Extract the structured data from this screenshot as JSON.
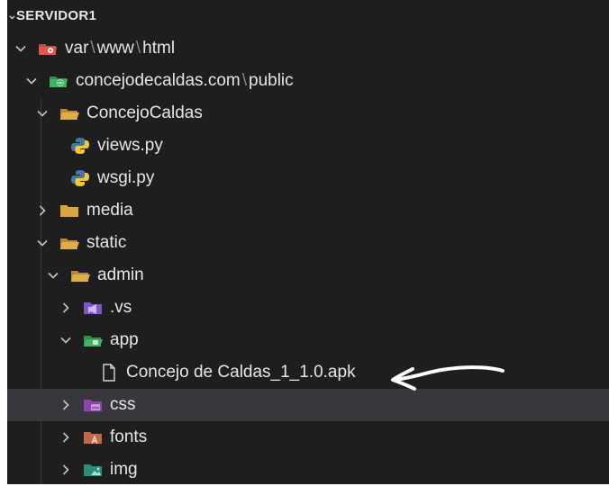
{
  "section": {
    "title": "SERVIDOR1"
  },
  "tree": {
    "root": {
      "part1": "var",
      "part2": "www",
      "part3": "html",
      "separator": "\\"
    },
    "site": {
      "part1": "concejodecaldas.com",
      "part2": "public",
      "separator": "\\"
    },
    "concejo_folder": "ConcejoCaldas",
    "views_file": "views.py",
    "wsgi_file": "wsgi.py",
    "media_folder": "media",
    "static_folder": "static",
    "admin_folder": "admin",
    "vs_folder": ".vs",
    "app_folder": "app",
    "apk_file": "Concejo de Caldas_1_1.0.apk",
    "css_folder": "css",
    "fonts_folder": "fonts",
    "img_folder": "img"
  },
  "icons": {
    "root": "red-folder-icon",
    "site": "green-world-folder-icon",
    "folder": "folder-open-icon",
    "python": "python-icon",
    "vs": "visual-studio-folder-icon",
    "app": "green-app-folder-icon",
    "file": "file-icon",
    "css": "purple-css-folder-icon",
    "fonts": "font-folder-icon",
    "img": "image-folder-icon"
  },
  "colors": {
    "background": "#1e1e1e",
    "highlight": "#37373d",
    "folder": "#d9a441",
    "text": "#e6e6e6"
  }
}
